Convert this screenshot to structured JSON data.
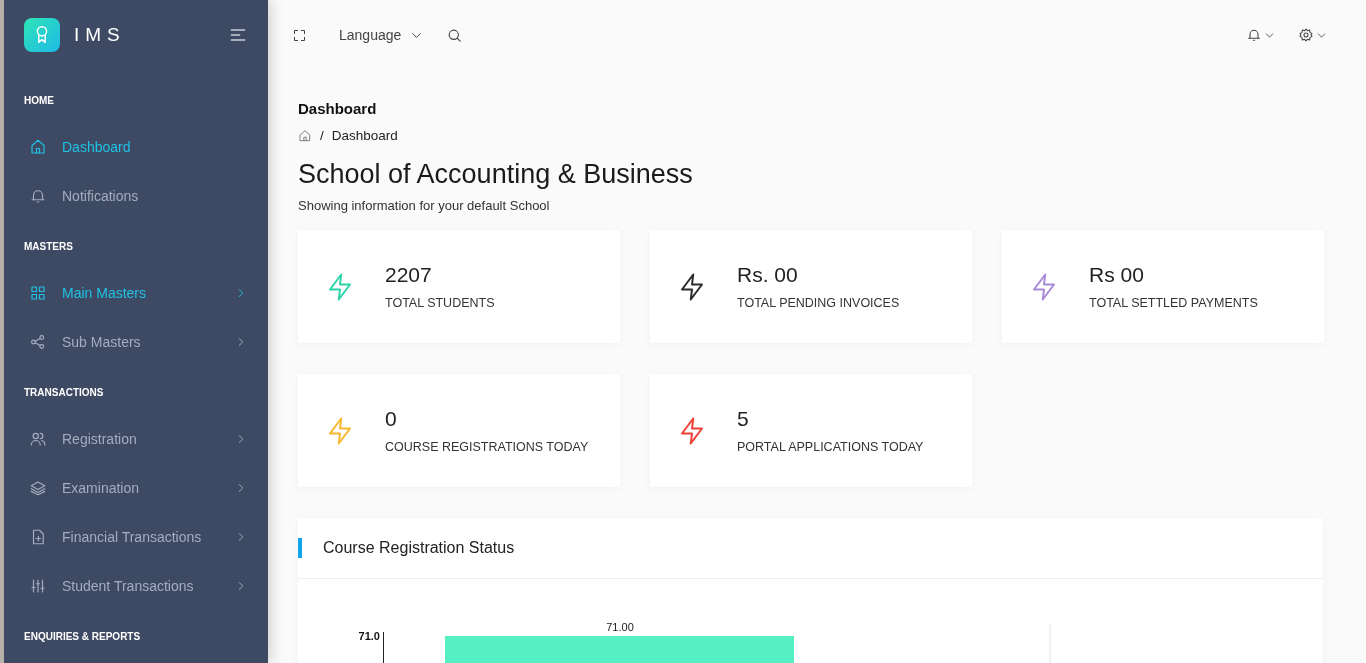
{
  "sidebar": {
    "brand": "IMS",
    "sections": [
      {
        "title": "HOME",
        "items": [
          {
            "label": "Dashboard",
            "active": true,
            "expandable": false
          },
          {
            "label": "Notifications",
            "active": false,
            "expandable": false
          }
        ]
      },
      {
        "title": "MASTERS",
        "items": [
          {
            "label": "Main Masters",
            "active": true,
            "expandable": true
          },
          {
            "label": "Sub Masters",
            "active": false,
            "expandable": true
          }
        ]
      },
      {
        "title": "TRANSACTIONS",
        "items": [
          {
            "label": "Registration",
            "active": false,
            "expandable": true
          },
          {
            "label": "Examination",
            "active": false,
            "expandable": true
          },
          {
            "label": "Financial Transactions",
            "active": false,
            "expandable": true
          },
          {
            "label": "Student Transactions",
            "active": false,
            "expandable": true
          }
        ]
      },
      {
        "title": "ENQUIRIES & REPORTS"
      }
    ]
  },
  "topbar": {
    "language": "Language"
  },
  "page": {
    "title": "Dashboard",
    "breadcrumb_separator": "/",
    "breadcrumb": "Dashboard",
    "heading": "School of Accounting & Business",
    "subheading": "Showing information for your default School"
  },
  "cards": [
    {
      "value": "2207",
      "label": "TOTAL STUDENTS",
      "color": "#2dd4a7"
    },
    {
      "value": "Rs. 00",
      "label": "TOTAL PENDING INVOICES",
      "color": "#2b2b2b"
    },
    {
      "value": "Rs 00",
      "label": "TOTAL SETTLED PAYMENTS",
      "color": "#a78bd8"
    },
    {
      "value": "0",
      "label": "COURSE REGISTRATIONS TODAY",
      "color": "#f5b82e"
    },
    {
      "value": "5",
      "label": "PORTAL APPLICATIONS TODAY",
      "color": "#ef4136"
    }
  ],
  "chart_panel": {
    "title": "Course Registration Status",
    "y_tick_label": "71.0",
    "bar_label": "71.00"
  }
}
